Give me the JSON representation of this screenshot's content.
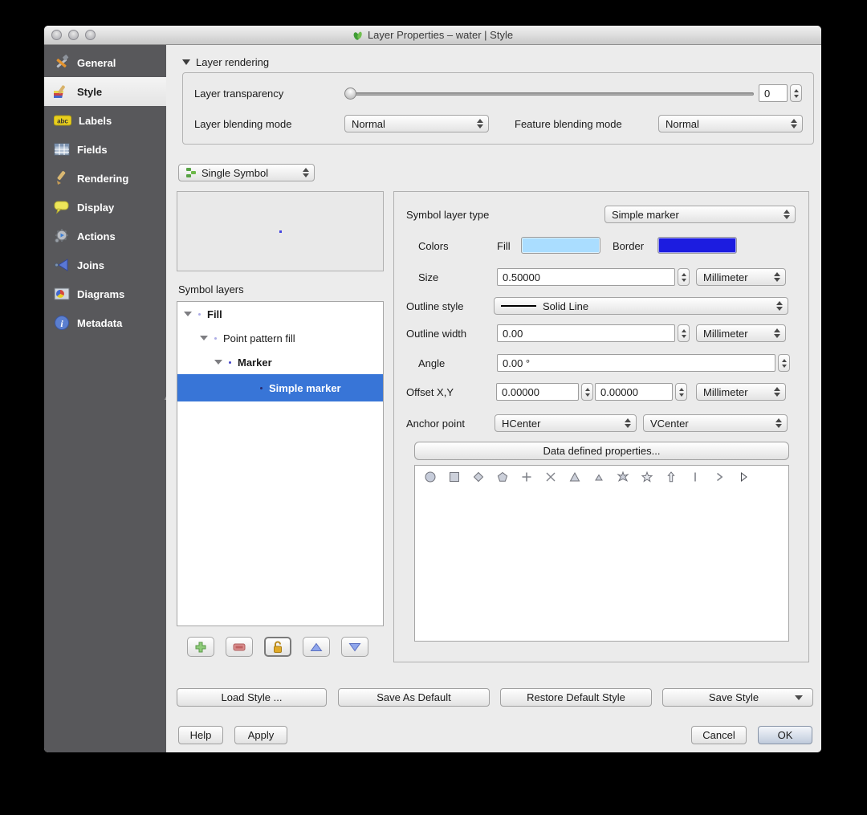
{
  "window": {
    "title": "Layer Properties – water | Style"
  },
  "sidebar": {
    "items": [
      {
        "label": "General",
        "icon": "tools-icon"
      },
      {
        "label": "Style",
        "icon": "paintbrush-icon",
        "selected": true
      },
      {
        "label": "Labels",
        "icon": "abc-icon"
      },
      {
        "label": "Fields",
        "icon": "table-icon"
      },
      {
        "label": "Rendering",
        "icon": "brush-icon"
      },
      {
        "label": "Display",
        "icon": "speech-bubble-icon"
      },
      {
        "label": "Actions",
        "icon": "gear-icon"
      },
      {
        "label": "Joins",
        "icon": "join-arrow-icon"
      },
      {
        "label": "Diagrams",
        "icon": "diagram-icon"
      },
      {
        "label": "Metadata",
        "icon": "info-icon"
      }
    ]
  },
  "layer_rendering": {
    "header": "Layer rendering",
    "transparency_label": "Layer transparency",
    "transparency_value": "0",
    "layer_blending_label": "Layer blending mode",
    "layer_blending_value": "Normal",
    "feature_blending_label": "Feature blending mode",
    "feature_blending_value": "Normal"
  },
  "renderer": {
    "selector_value": "Single Symbol"
  },
  "symbol_layers": {
    "label": "Symbol layers",
    "tree": [
      {
        "label": "Fill"
      },
      {
        "label": "Point pattern fill"
      },
      {
        "label": "Marker"
      },
      {
        "label": "Simple marker",
        "selected": true
      }
    ]
  },
  "layer_props": {
    "symbol_layer_type_label": "Symbol layer type",
    "symbol_layer_type_value": "Simple marker",
    "colors_label": "Colors",
    "fill_label": "Fill",
    "fill_color": "#aaddff",
    "border_label": "Border",
    "border_color": "#1c1ce0",
    "size_label": "Size",
    "size_value": "0.50000",
    "size_unit": "Millimeter",
    "outline_style_label": "Outline style",
    "outline_style_value": "Solid Line",
    "outline_width_label": "Outline width",
    "outline_width_value": "0.00",
    "outline_width_unit": "Millimeter",
    "angle_label": "Angle",
    "angle_value": "0.00 °",
    "offset_label": "Offset X,Y",
    "offset_x_value": "0.00000",
    "offset_y_value": "0.00000",
    "offset_unit": "Millimeter",
    "anchor_label": "Anchor point",
    "anchor_h_value": "HCenter",
    "anchor_v_value": "VCenter",
    "data_defined_button": "Data defined properties..."
  },
  "marker_palette": {
    "shapes": [
      "circle",
      "square",
      "diamond",
      "pentagon",
      "plus",
      "cross",
      "triangle",
      "equilateral-triangle",
      "star-burst",
      "star",
      "arrow-up",
      "vertical-line",
      "chevron-right",
      "arrowhead-right"
    ]
  },
  "footer": {
    "load_style": "Load Style ...",
    "save_as_default": "Save As Default",
    "restore_default": "Restore Default Style",
    "save_style": "Save Style",
    "help": "Help",
    "apply": "Apply",
    "cancel": "Cancel",
    "ok": "OK"
  },
  "colors": {
    "selection_blue": "#3875d7",
    "sidebar_bg": "#58585b"
  }
}
